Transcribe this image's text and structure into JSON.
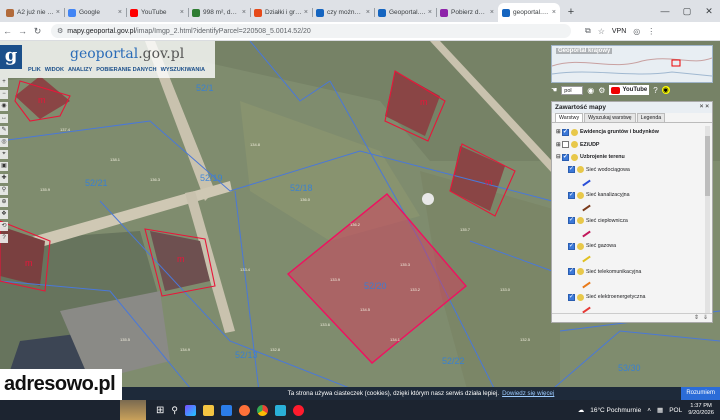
{
  "browser": {
    "tabs": [
      {
        "title": "A2 już nie ma. Właśc",
        "color": "#b26b3b",
        "active": false
      },
      {
        "title": "Google",
        "color": "#4285f4",
        "active": false
      },
      {
        "title": "YouTube",
        "color": "#ff0000",
        "active": false
      },
      {
        "title": "998 m², działka bud",
        "color": "#2e7d32",
        "active": false
      },
      {
        "title": "Działki i grunty - str",
        "color": "#e64a19",
        "active": false
      },
      {
        "title": "czy można wykopa",
        "color": "#1565c0",
        "active": false
      },
      {
        "title": "Geoportal.gov.pl",
        "color": "#1565c0",
        "active": false
      },
      {
        "title": "Pobierz dane - GUG",
        "color": "#8e24aa",
        "active": false
      },
      {
        "title": "geoportal.gov.pl",
        "color": "#1565c0",
        "active": true
      }
    ],
    "new_tab": "+",
    "url_domain": "mapy.geoportal.gov.pl",
    "url_path": "/imap/Imgp_2.html?identifyParcel=220508_5.0014.52/20",
    "vpn": "VPN"
  },
  "geoportal": {
    "logo_letter": "g",
    "logo_pre": "geoportal",
    "logo_post": ".gov.pl",
    "menu": [
      "PLIK",
      "WIDOK",
      "ANALIZY",
      "POBIERANIE DANYCH",
      "WYSZUKIWANIA"
    ],
    "left_tools": [
      "+",
      "−",
      "◉",
      "↔",
      "✎",
      "◎",
      "⌖",
      "▣",
      "✚",
      "⚲",
      "⊕",
      "❖",
      "⟲",
      "?"
    ],
    "overview_title": "Geoportal krajowy",
    "layer_select": "pol",
    "youtube_label": "YouTube"
  },
  "panel": {
    "title": "Zawartość mapy",
    "close": "× ×",
    "tabs": [
      {
        "label": "Warstwy",
        "on": true
      },
      {
        "label": "Wyszukaj warstwę",
        "on": false
      },
      {
        "label": "Legenda",
        "on": false
      }
    ],
    "layers": [
      {
        "label": "Ewidencja gruntów i budynków",
        "checked": true,
        "bold": true,
        "toggle": "⊞",
        "sub": false
      },
      {
        "label": "EZiUDP",
        "checked": false,
        "bold": true,
        "toggle": "⊞",
        "sub": false
      },
      {
        "label": "Uzbrojenie terenu",
        "checked": true,
        "bold": true,
        "toggle": "⊟",
        "sub": false
      },
      {
        "label": "Sieć wodociągowa",
        "checked": true,
        "bold": false,
        "toggle": "",
        "sub": true,
        "sym": "#2a4fd8"
      },
      {
        "label": "Sieć kanalizacyjna",
        "checked": true,
        "bold": false,
        "toggle": "",
        "sub": true,
        "sym": "#7a3a1a"
      },
      {
        "label": "Sieć ciepłownicza",
        "checked": true,
        "bold": false,
        "toggle": "",
        "sub": true,
        "sym": "#c2185b"
      },
      {
        "label": "Sieć gazowa",
        "checked": true,
        "bold": false,
        "toggle": "",
        "sub": true,
        "sym": "#e0c020"
      },
      {
        "label": "Sieć telekomunikacyjna",
        "checked": true,
        "bold": false,
        "toggle": "",
        "sub": true,
        "sym": "#e87a1a"
      },
      {
        "label": "Sieć elektroenergetyczna",
        "checked": true,
        "bold": false,
        "toggle": "",
        "sub": true,
        "sym": "#e53935"
      }
    ],
    "foot": [
      "⇕",
      "⇓"
    ]
  },
  "map": {
    "parcel_numbers": [
      "52/20",
      "52/19",
      "52/21",
      "52/18",
      "52/13",
      "52/22",
      "53/30",
      "52/1"
    ],
    "building_symbol": "m"
  },
  "site": {
    "brand_pre": "adresowo",
    "brand_post": ".pl"
  },
  "cookie": {
    "text": "Ta strona używa ciasteczek (cookies), dzięki którym nasz serwis działa lepiej.",
    "link": "Dowiedz się więcej",
    "button": "Rozumiem"
  },
  "taskbar": {
    "weather": "16°C  Pochmurnie",
    "lang": "POL",
    "time": "1:37 PM",
    "date": "9/20/2026"
  }
}
